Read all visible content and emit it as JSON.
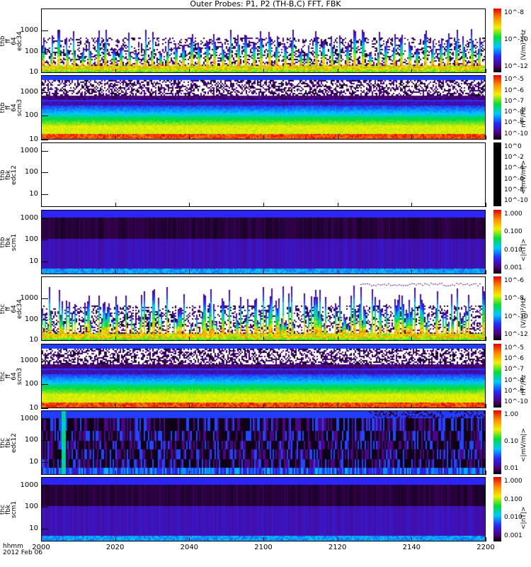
{
  "title": "Outer Probes: P1, P2 (TH-B,C) FFT, FBK",
  "chart_data": {
    "type": "heatmap",
    "title": "Outer Probes: P1, P2 (TH-B,C) FFT, FBK",
    "x_axis": {
      "label_line1": "hhmm",
      "label_line2": "2012 Feb 06",
      "ticks": [
        "2000",
        "2020",
        "2040",
        "2100",
        "2120",
        "2140",
        "2200"
      ],
      "range": [
        "20:00",
        "22:00"
      ]
    },
    "panels": [
      {
        "ylabel": [
          "thb",
          "ff",
          "64",
          "edc34"
        ],
        "yscale": "log",
        "yticks": [
          "10",
          "100",
          "1000"
        ],
        "ylim": [
          8,
          8000
        ],
        "zscale": "log",
        "zticks": [
          "10^-8",
          "10^-10",
          "10^-12"
        ],
        "zunit": "(V/m)²/Hz",
        "kind": "efi"
      },
      {
        "ylabel": [
          "thb",
          "ff",
          "64",
          "scm3"
        ],
        "yscale": "log",
        "yticks": [
          "10",
          "100",
          "1000"
        ],
        "ylim": [
          8,
          4000
        ],
        "zscale": "log",
        "zticks": [
          "10^-5",
          "10^-6",
          "10^-7",
          "10^-8",
          "10^-9",
          "10^-10"
        ],
        "zunit": "nT²/Hz",
        "kind": "scm"
      },
      {
        "ylabel": [
          "thb",
          "fbk",
          "edc12"
        ],
        "yscale": "log",
        "yticks": [
          "10",
          "100",
          "1000"
        ],
        "ylim": [
          2.5,
          2300
        ],
        "zscale": "log",
        "zticks": [
          "10^0",
          "10^-2",
          "10^-4",
          "10^-6",
          "10^-8",
          "10^-10"
        ],
        "zunit": "<|mV/m|>",
        "kind": "empty"
      },
      {
        "ylabel": [
          "thb",
          "fbk",
          "scm1"
        ],
        "yscale": "log",
        "yticks": [
          "10",
          "100",
          "1000"
        ],
        "ylim": [
          2.5,
          2300
        ],
        "zscale": "log",
        "zticks": [
          "1.000",
          "0.100",
          "0.010",
          "0.001"
        ],
        "zunit": "<|nT|>",
        "kind": "fbk"
      },
      {
        "ylabel": [
          "thc",
          "ff",
          "64",
          "edc34"
        ],
        "yscale": "log",
        "yticks": [
          "10",
          "100",
          "1000"
        ],
        "ylim": [
          8,
          8000
        ],
        "zscale": "log",
        "zticks": [
          "10^-6",
          "10^-8",
          "10^-10",
          "10^-12"
        ],
        "zunit": "(V/m)²/Hz",
        "kind": "efi2"
      },
      {
        "ylabel": [
          "thc",
          "ff",
          "64",
          "scm3"
        ],
        "yscale": "log",
        "yticks": [
          "10",
          "100",
          "1000"
        ],
        "ylim": [
          8,
          4000
        ],
        "zscale": "log",
        "zticks": [
          "10^-5",
          "10^-6",
          "10^-7",
          "10^-8",
          "10^-9",
          "10^-10"
        ],
        "zunit": "nT²/Hz",
        "kind": "scm"
      },
      {
        "ylabel": [
          "thc",
          "fbk",
          "edc12"
        ],
        "yscale": "log",
        "yticks": [
          "10",
          "100",
          "1000"
        ],
        "ylim": [
          2.5,
          2300
        ],
        "zscale": "log",
        "zticks": [
          "1.00",
          "0.10",
          "0.01"
        ],
        "zunit": "<|mV/m|>",
        "kind": "fbkvar"
      },
      {
        "ylabel": [
          "thc",
          "fbk",
          "scm1"
        ],
        "yscale": "log",
        "yticks": [
          "10",
          "100",
          "1000"
        ],
        "ylim": [
          2.5,
          2300
        ],
        "zscale": "log",
        "zticks": [
          "1.000",
          "0.100",
          "0.010",
          "0.001"
        ],
        "zunit": "<|nT|>",
        "kind": "fbk"
      }
    ]
  }
}
